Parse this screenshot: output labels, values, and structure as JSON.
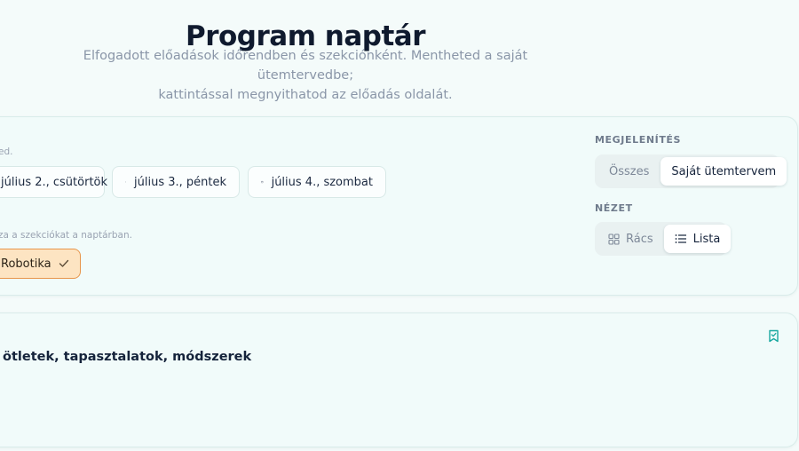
{
  "header": {
    "title": "Program naptár",
    "subtitle_line1": "Elfogadott előadások időrendben és szekciónként. Mentheted a saját ütemtervedbe;",
    "subtitle_line2": "kattintással megnyithatod az előadás oldalát."
  },
  "filters": {
    "day_hint": "ed.",
    "days": [
      {
        "label": "július 2., csütörtök",
        "icon": "calendar-icon"
      },
      {
        "label": "július 3., péntek",
        "icon": "calendar-icon"
      },
      {
        "label": "július 4., szombat",
        "icon": "calendar-icon"
      }
    ],
    "section_hint": "za a szekciókat a naptárban.",
    "sections": [
      {
        "label": "Robotika",
        "selected": true,
        "icon": "check-icon"
      }
    ]
  },
  "display": {
    "label": "MEGJELENÍTÉS",
    "options": [
      {
        "label": "Összes",
        "active": false
      },
      {
        "label": "Saját ütemtervem",
        "active": true
      }
    ]
  },
  "view": {
    "label": "NÉZET",
    "options": [
      {
        "label": "Rács",
        "icon": "grid-icon",
        "active": false
      },
      {
        "label": "Lista",
        "icon": "list-icon",
        "active": true
      }
    ]
  },
  "session": {
    "title": "ötletek, tapasztalatok, módszerek",
    "bookmark_icon": "bookmark-check-icon"
  },
  "colors": {
    "accent": "#19a8a0",
    "tag_bg": "#fde4c2",
    "tag_border": "#e8954a"
  }
}
